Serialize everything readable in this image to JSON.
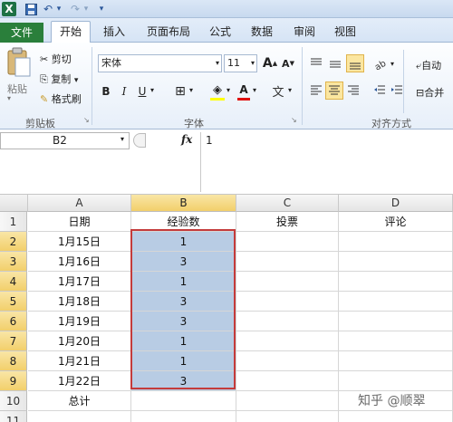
{
  "quick_access": {
    "excel_icon": "X",
    "save_icon": "save-icon",
    "undo_icon": "↶",
    "redo_icon": "↷",
    "more_icon": "▾"
  },
  "tabs": [
    "文件",
    "开始",
    "插入",
    "页面布局",
    "公式",
    "数据",
    "审阅",
    "视图"
  ],
  "clipboard": {
    "paste_label": "粘贴",
    "cut_label": "剪切",
    "copy_label": "复制",
    "copy_arrow": "▾",
    "format_painter_label": "格式刷",
    "group_label": "剪贴板"
  },
  "font": {
    "font_name": "宋体",
    "font_size": "11",
    "grow_label": "A",
    "shrink_label": "A",
    "bold_label": "B",
    "italic_label": "I",
    "underline_label": "U",
    "border_label": "⊞",
    "fill_label": "◈",
    "font_color_label": "A",
    "wen_label": "文",
    "group_label": "字体"
  },
  "alignment": {
    "wrap_label": "自动",
    "merge_label": "合并",
    "group_label": "对齐方式"
  },
  "formula_bar": {
    "name_box": "B2",
    "fx_label": "fx",
    "value": "1"
  },
  "columns": [
    "A",
    "B",
    "C",
    "D"
  ],
  "rows": [
    {
      "num": "1",
      "cells": [
        "日期",
        "经验数",
        "投票",
        "评论"
      ]
    },
    {
      "num": "2",
      "cells": [
        "1月15日",
        "1",
        "",
        ""
      ]
    },
    {
      "num": "3",
      "cells": [
        "1月16日",
        "3",
        "",
        ""
      ]
    },
    {
      "num": "4",
      "cells": [
        "1月17日",
        "1",
        "",
        ""
      ]
    },
    {
      "num": "5",
      "cells": [
        "1月18日",
        "3",
        "",
        ""
      ]
    },
    {
      "num": "6",
      "cells": [
        "1月19日",
        "3",
        "",
        ""
      ]
    },
    {
      "num": "7",
      "cells": [
        "1月20日",
        "1",
        "",
        ""
      ]
    },
    {
      "num": "8",
      "cells": [
        "1月21日",
        "1",
        "",
        ""
      ]
    },
    {
      "num": "9",
      "cells": [
        "1月22日",
        "3",
        "",
        ""
      ]
    },
    {
      "num": "10",
      "cells": [
        "总计",
        "",
        "",
        ""
      ]
    },
    {
      "num": "11",
      "cells": [
        "",
        "",
        "",
        ""
      ]
    }
  ],
  "selection": {
    "range": "B2:B9",
    "highlight_color": "#b8cce4",
    "border_color": "#c43b3b"
  },
  "watermark": "知乎 @顺翠"
}
